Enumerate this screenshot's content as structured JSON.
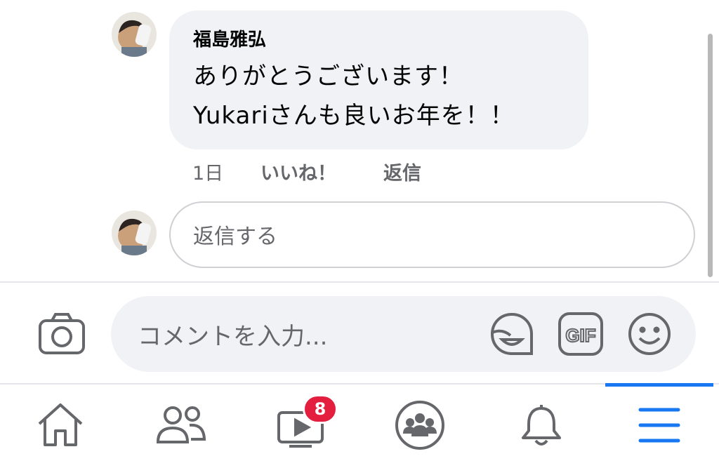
{
  "comment": {
    "author": "福島雅弘",
    "message_line1": "ありがとうございます！",
    "message_line2": "Yukariさんも良いお年を！！",
    "time": "1日",
    "like_label": "いいね！",
    "reply_label": "返信"
  },
  "reply_input": {
    "placeholder": "返信する"
  },
  "comment_input": {
    "placeholder": "コメントを入力..."
  },
  "nav": {
    "items": [
      "home-icon",
      "friends-icon",
      "watch-icon",
      "groups-icon",
      "notifications-icon",
      "menu-icon"
    ],
    "watch_badge": "8",
    "active_item": "menu-icon"
  },
  "colors": {
    "accent": "#1877f2",
    "badge": "#e41e3f",
    "icon": "#65676b"
  }
}
